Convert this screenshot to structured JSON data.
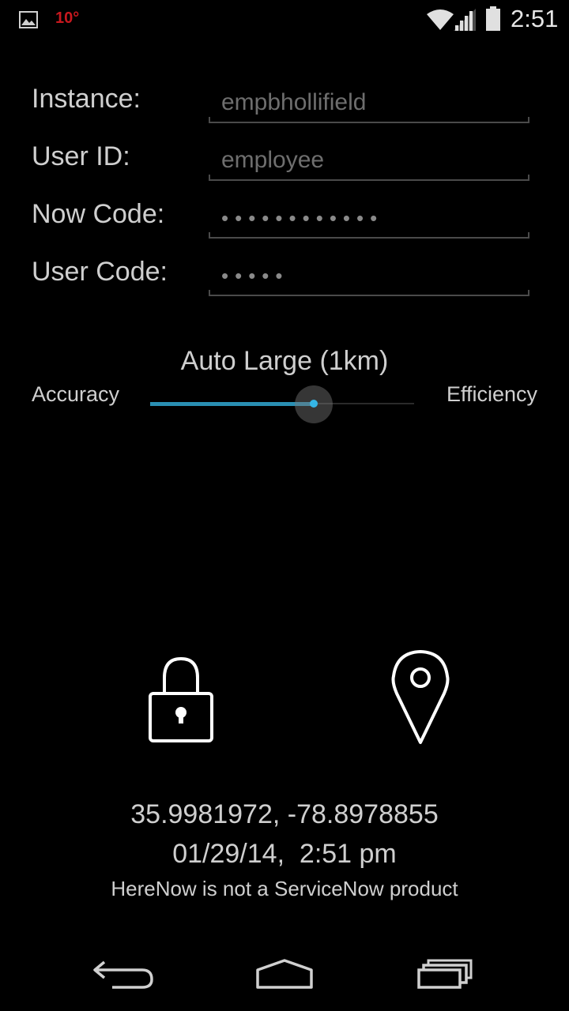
{
  "status_bar": {
    "notification_icon": "gallery-icon",
    "temperature": "10°",
    "time": "2:51",
    "colors": {
      "temperature": "#c8181e"
    }
  },
  "form": {
    "instance": {
      "label": "Instance:",
      "value": "empbhollifield"
    },
    "user_id": {
      "label": "User ID:",
      "value": "employee"
    },
    "now_code": {
      "label": "Now Code:",
      "value": "••••••••••••"
    },
    "user_code": {
      "label": "User Code:",
      "value": "•••••"
    }
  },
  "accuracy_slider": {
    "title": "Auto Large (1km)",
    "left_label": "Accuracy",
    "right_label": "Efficiency",
    "position_fraction": 0.62,
    "accent_color": "#35b5e5"
  },
  "actions": {
    "lock_icon": "lock-icon",
    "location_icon": "map-pin-icon"
  },
  "info": {
    "coordinates": "35.9981972, -78.8978855",
    "datetime": "01/29/14,  2:51 pm",
    "disclaimer": "HereNow is not a ServiceNow product"
  },
  "nav_bar": {
    "back_icon": "back-icon",
    "home_icon": "home-icon",
    "recents_icon": "recents-icon"
  }
}
